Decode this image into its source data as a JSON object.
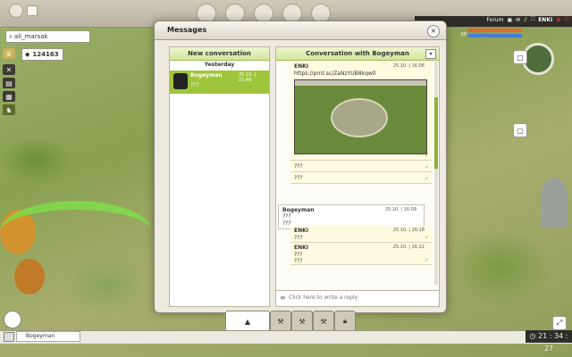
{
  "topbar": {
    "username_label": "ENKI",
    "forum_label": "Forum",
    "xp_label": "XP"
  },
  "search": {
    "value": "ali_marsak"
  },
  "resource": {
    "value": "124163"
  },
  "dialog": {
    "title": "Messages",
    "close_label": "×",
    "new_conversation_label": "New conversation",
    "yesterday_label": "Yesterday",
    "conversations": [
      {
        "name": "Bogeyman",
        "time": "25.10. | 21:49",
        "preview": "???"
      }
    ],
    "conversation_header": "Conversation with Bogeyman",
    "messages": [
      {
        "author": "ENKI",
        "time": "25.10. | 16:06",
        "text": "https://prnt.sc/ZaNzYUB8kqw0"
      },
      {
        "author": "",
        "time": "",
        "text": "???"
      },
      {
        "author": "",
        "time": "",
        "text": "???"
      },
      {
        "author": "Bogeyman",
        "time": "25.10. | 16:09",
        "text": "???",
        "text2": "???"
      },
      {
        "author": "ENKI",
        "time": "25.10. | 16:18",
        "text": "???"
      },
      {
        "author": "ENKI",
        "time": "25.10. | 16:22",
        "text": "???",
        "text2": "???"
      }
    ],
    "write_placeholder": "Click here to write a reply"
  },
  "bottom": {
    "chat_tab": "Bogeyman",
    "clock": "21 : 34 : 27"
  },
  "colors": {
    "accent_green": "#9fc53d",
    "header_green": "#d4e69a",
    "message_yellow": "#fffbe0"
  }
}
